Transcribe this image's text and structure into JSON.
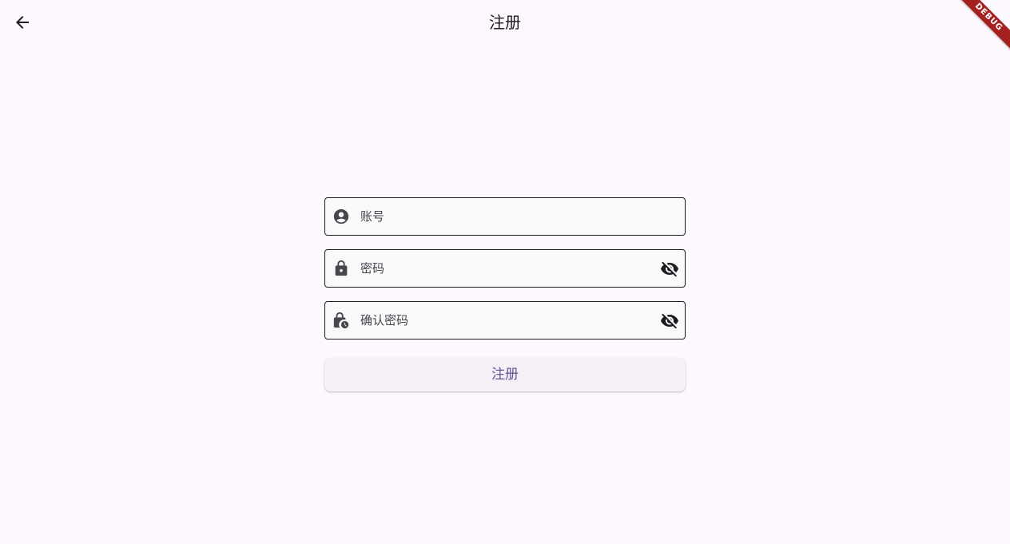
{
  "app_bar": {
    "title": "注册",
    "back_icon": "arrow-back-icon"
  },
  "debug_banner": {
    "label": "DEBUG",
    "color": "#a5211f"
  },
  "form": {
    "fields": [
      {
        "placeholder": "账号",
        "lead_icon": "account-circle-icon"
      },
      {
        "placeholder": "密码",
        "lead_icon": "lock-icon",
        "trail_icon": "visibility-off-icon"
      },
      {
        "placeholder": "确认密码",
        "lead_icon": "lock-clock-icon",
        "trail_icon": "visibility-off-icon"
      }
    ],
    "submit_label": "注册"
  },
  "colors": {
    "background": "#fdf7fe",
    "accent": "#65558f",
    "button_bg": "#f5eff7",
    "field_bg": "#f9f9f9"
  }
}
